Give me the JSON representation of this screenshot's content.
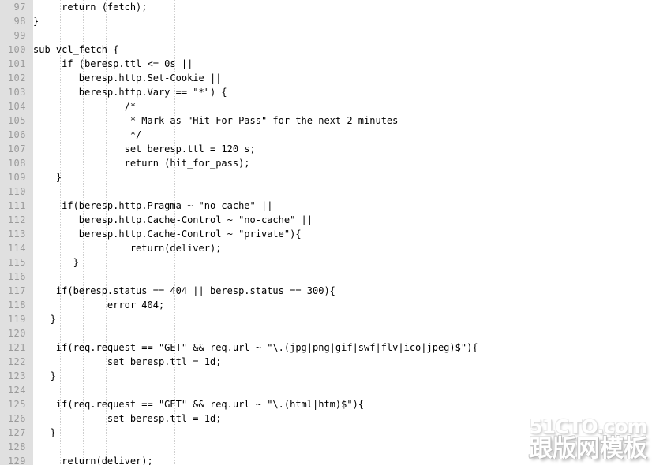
{
  "editor": {
    "language": "VCL",
    "first_line": 97,
    "last_line": 129,
    "gutter_color": "#e0e0e0",
    "line_number_color": "#9a9a9a",
    "code_color": "#000000",
    "background_color": "#ffffff",
    "indent_guide_color": "#cfcfcf"
  },
  "lines": [
    {
      "number": "97",
      "code": "     return (fetch);"
    },
    {
      "number": "98",
      "code": "}"
    },
    {
      "number": "99",
      "code": ""
    },
    {
      "number": "100",
      "code": "sub vcl_fetch {"
    },
    {
      "number": "101",
      "code": "     if (beresp.ttl <= 0s ||"
    },
    {
      "number": "102",
      "code": "        beresp.http.Set-Cookie ||"
    },
    {
      "number": "103",
      "code": "        beresp.http.Vary == \"*\") {"
    },
    {
      "number": "104",
      "code": "                /*"
    },
    {
      "number": "105",
      "code": "                 * Mark as \"Hit-For-Pass\" for the next 2 minutes"
    },
    {
      "number": "106",
      "code": "                 */"
    },
    {
      "number": "107",
      "code": "                set beresp.ttl = 120 s;"
    },
    {
      "number": "108",
      "code": "                return (hit_for_pass);"
    },
    {
      "number": "109",
      "code": "    }"
    },
    {
      "number": "110",
      "code": ""
    },
    {
      "number": "111",
      "code": "     if(beresp.http.Pragma ~ \"no-cache\" ||"
    },
    {
      "number": "112",
      "code": "        beresp.http.Cache-Control ~ \"no-cache\" ||"
    },
    {
      "number": "113",
      "code": "        beresp.http.Cache-Control ~ \"private\"){"
    },
    {
      "number": "114",
      "code": "                 return(deliver);"
    },
    {
      "number": "115",
      "code": "       }"
    },
    {
      "number": "116",
      "code": ""
    },
    {
      "number": "117",
      "code": "    if(beresp.status == 404 || beresp.status == 300){"
    },
    {
      "number": "118",
      "code": "             error 404;"
    },
    {
      "number": "119",
      "code": "   }"
    },
    {
      "number": "120",
      "code": ""
    },
    {
      "number": "121",
      "code": "    if(req.request == \"GET\" && req.url ~ \"\\.(jpg|png|gif|swf|flv|ico|jpeg)$\"){"
    },
    {
      "number": "122",
      "code": "             set beresp.ttl = 1d;"
    },
    {
      "number": "123",
      "code": "   }"
    },
    {
      "number": "124",
      "code": ""
    },
    {
      "number": "125",
      "code": "    if(req.request == \"GET\" && req.url ~ \"\\.(html|htm)$\"){"
    },
    {
      "number": "126",
      "code": "             set beresp.ttl = 1d;"
    },
    {
      "number": "127",
      "code": "   }"
    },
    {
      "number": "128",
      "code": ""
    },
    {
      "number": "129",
      "code": "     return(deliver);"
    }
  ],
  "indent_guides": [
    76,
    105,
    134,
    163,
    192,
    221
  ],
  "watermark": {
    "top_text": "51CTO.com",
    "bottom_text": "跟版网模板"
  }
}
